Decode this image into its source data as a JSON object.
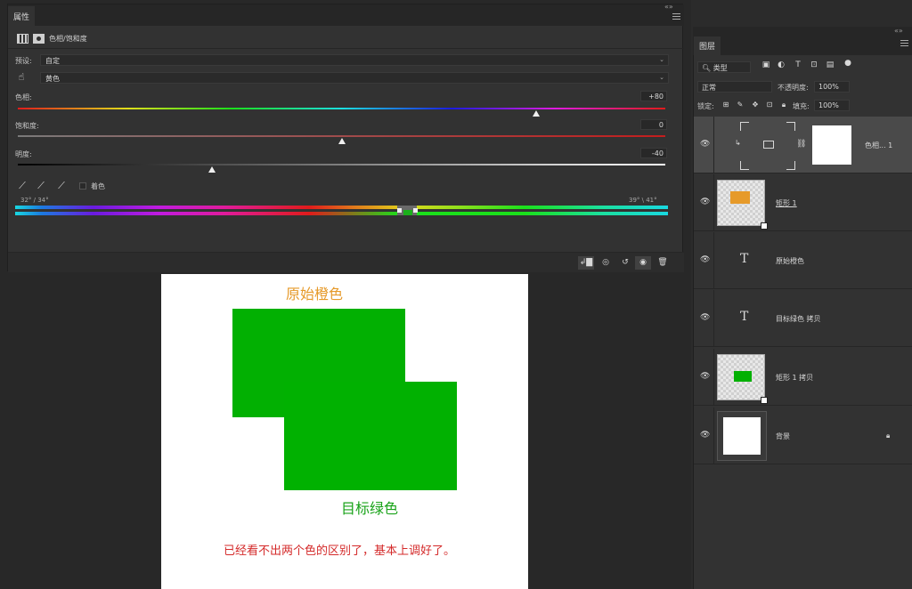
{
  "properties_panel": {
    "tab_label": "属性",
    "title": "色相/饱和度",
    "preset_label": "预设:",
    "preset_value": "自定",
    "channel_value": "黄色",
    "hue_label": "色相:",
    "hue_value": "+80",
    "hue_fraction": 0.8,
    "saturation_label": "饱和度:",
    "saturation_value": "0",
    "saturation_fraction": 0.5,
    "lightness_label": "明度:",
    "lightness_value": "-40",
    "lightness_fraction": 0.3,
    "colorize_label": "着色",
    "range_left": "32° / 34°",
    "range_right": "39° \\ 41°",
    "bottom_buttons": [
      "clip-to-layer-icon",
      "view-previous-icon",
      "reset-icon",
      "visibility-icon",
      "trash-icon"
    ]
  },
  "document": {
    "label_original": "原始橙色",
    "label_target": "目标绿色",
    "note": "已经看不出两个色的区别了，基本上调好了。",
    "rect_color": "#01b101",
    "label_original_color": "#e69a2a",
    "label_target_color": "#19a319",
    "note_color": "#d42a2a"
  },
  "layers_panel": {
    "tab_label": "图层",
    "filter_value": "类型",
    "blend_mode": "正常",
    "opacity_label": "不透明度:",
    "opacity_value": "100%",
    "lock_label": "锁定:",
    "fill_label": "填充:",
    "fill_value": "100%",
    "layers": [
      {
        "name": "色相... 1",
        "kind": "adjustment",
        "selected": true
      },
      {
        "name": "矩形 1",
        "kind": "shape-orange"
      },
      {
        "name": "原始橙色",
        "kind": "text"
      },
      {
        "name": "目标绿色 拷贝",
        "kind": "text"
      },
      {
        "name": "矩形 1 拷贝",
        "kind": "shape-green"
      },
      {
        "name": "背景",
        "kind": "background",
        "locked": true
      }
    ]
  }
}
